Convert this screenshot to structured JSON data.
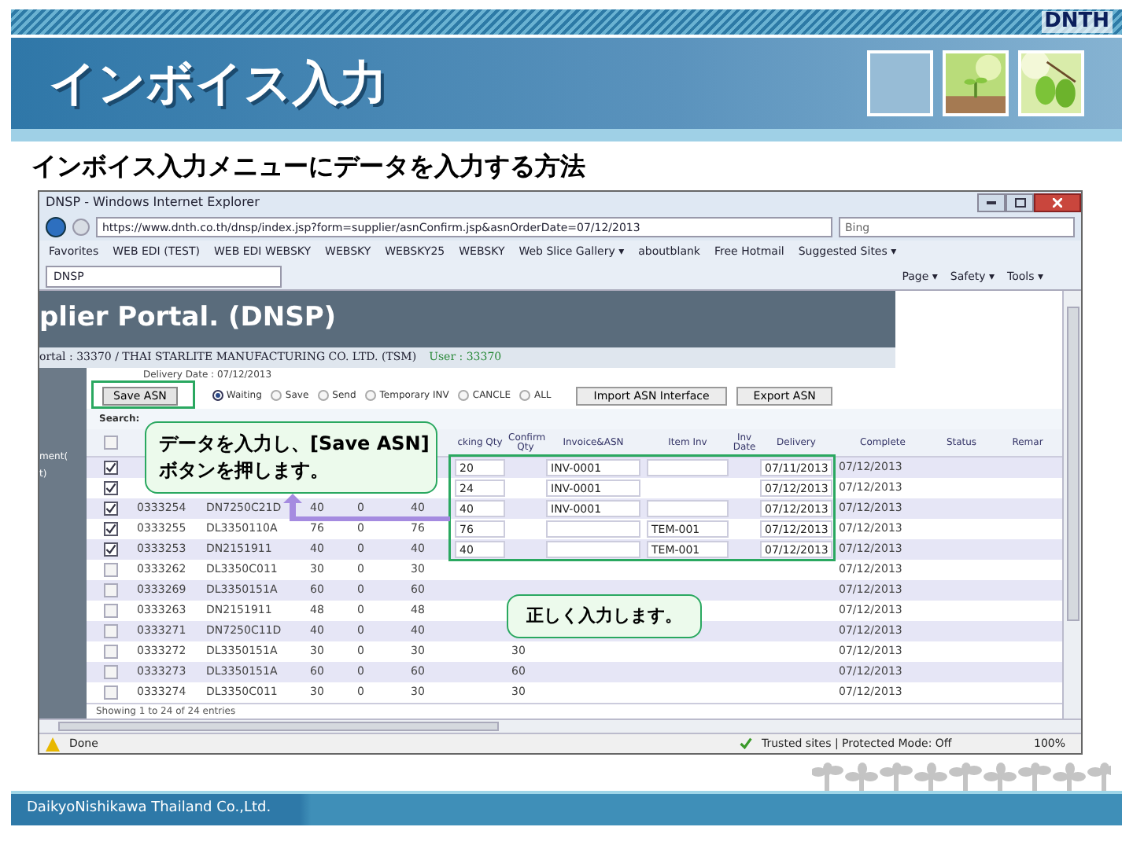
{
  "slide": {
    "logo": "DNTH",
    "title": "インボイス入力",
    "subtitle": "インボイス入力メニューにデータを入力する方法",
    "footer": "DaikyoNishikawa Thailand Co.,Ltd."
  },
  "browser": {
    "title": "DNSP - Windows Internet Explorer",
    "address": "https://www.dnth.co.th/dnsp/index.jsp?form=supplier/asnConfirm.jsp&asnOrderDate=07/12/2013",
    "search_placeholder": "Bing",
    "favorites": [
      "Favorites",
      "WEB EDI (TEST)",
      "WEB EDI WEBSKY",
      "WEBSKY",
      "WEBSKY25",
      "WEBSKY",
      "Web Slice Gallery ▾",
      "aboutblank",
      "Free Hotmail",
      "Suggested Sites ▾"
    ],
    "tab": "DNSP",
    "commands": [
      "Page ▾",
      "Safety ▾",
      "Tools ▾"
    ],
    "status": "Done",
    "zone": "Trusted sites | Protected Mode: Off",
    "zoom": "100%"
  },
  "portal": {
    "banner": "plier Portal.  (DNSP)",
    "company": "ortal : 33370 / THAI STARLITE MANUFACTURING CO. LTD. (TSM)",
    "user": "User : 33370",
    "date_line": "Delivery Date : 07/12/2013",
    "sidebar": [
      "ment(",
      "t)"
    ],
    "save_button": "Save ASN",
    "filters": [
      {
        "label": "Waiting",
        "selected": true
      },
      {
        "label": "Save",
        "selected": false
      },
      {
        "label": "Send",
        "selected": false
      },
      {
        "label": "Temporary INV",
        "selected": false
      },
      {
        "label": "CANCLE",
        "selected": false
      },
      {
        "label": "ALL",
        "selected": false
      }
    ],
    "buttons": [
      "Import ASN Interface",
      "Export ASN"
    ],
    "search_label": "Search:",
    "header_checked": false,
    "header": [
      "cking Qty",
      "Confirm Qty",
      "Invoice&ASN",
      "Item Inv",
      "Inv Date",
      "Delivery",
      "Complete",
      "Status",
      "Remar"
    ],
    "rows": [
      {
        "checked": true,
        "pick": "20",
        "invoice": "INV-0001",
        "item": "",
        "date": "07/11/2013",
        "complete": "07/12/2013"
      },
      {
        "checked": true,
        "pick": "24",
        "invoice": "INV-0001",
        "date": "07/12/2013",
        "complete": "07/12/2013"
      },
      {
        "checked": true,
        "order": "0333254",
        "part": "DN7250C21D",
        "qty": "40",
        "received": "0",
        "remain": "40",
        "pick": "40",
        "invoice": "INV-0001",
        "item": "",
        "date": "07/12/2013",
        "complete": "07/12/2013"
      },
      {
        "checked": true,
        "order": "0333255",
        "part": "DL3350110A",
        "qty": "76",
        "received": "0",
        "remain": "76",
        "pick": "76",
        "invoice": "",
        "item": "TEM-001",
        "date": "07/12/2013",
        "complete": "07/12/2013"
      },
      {
        "checked": true,
        "order": "0333253",
        "part": "DN2151911",
        "qty": "40",
        "received": "0",
        "remain": "40",
        "pick": "40",
        "invoice": "",
        "item": "TEM-001",
        "date": "07/12/2013",
        "complete": "07/12/2013"
      },
      {
        "checked": false,
        "order": "0333262",
        "part": "DL3350C011",
        "qty": "30",
        "received": "0",
        "remain": "30",
        "complete": "07/12/2013"
      },
      {
        "checked": false,
        "order": "0333269",
        "part": "DL3350151A",
        "qty": "60",
        "received": "0",
        "remain": "60",
        "complete": "07/12/2013"
      },
      {
        "checked": false,
        "order": "0333263",
        "part": "DN2151911",
        "qty": "48",
        "received": "0",
        "remain": "48",
        "complete": "07/12/2013"
      },
      {
        "checked": false,
        "order": "0333271",
        "part": "DN7250C11D",
        "qty": "40",
        "received": "0",
        "remain": "40",
        "complete": "07/12/2013"
      },
      {
        "checked": false,
        "order": "0333272",
        "part": "DL3350151A",
        "qty": "30",
        "received": "0",
        "remain": "30",
        "confirm": "30",
        "complete": "07/12/2013"
      },
      {
        "checked": false,
        "order": "0333273",
        "part": "DL3350151A",
        "qty": "60",
        "received": "0",
        "remain": "60",
        "confirm": "60",
        "complete": "07/12/2013"
      },
      {
        "checked": false,
        "order": "0333274",
        "part": "DL3350C011",
        "qty": "30",
        "received": "0",
        "remain": "30",
        "confirm": "30",
        "complete": "07/12/2013"
      }
    ],
    "showing": "Showing 1 to 24 of 24 entries"
  },
  "callouts": [
    "データを入力し、[Save ASN]\nボタンを押します。",
    "正しく入力します。"
  ]
}
